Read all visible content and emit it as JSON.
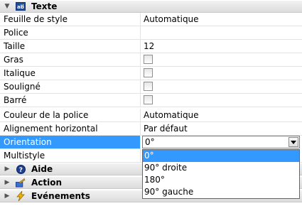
{
  "categories": {
    "texte": {
      "label": "Texte",
      "icon": "text-field-icon"
    },
    "aide": {
      "label": "Aide",
      "icon": "help-icon"
    },
    "action": {
      "label": "Action",
      "icon": "action-icon"
    },
    "evenements": {
      "label": "Evénements",
      "icon": "lightning-icon"
    }
  },
  "properties": {
    "feuille_de_style": {
      "label": "Feuille de style",
      "value": "Automatique"
    },
    "police": {
      "label": "Police",
      "value": ""
    },
    "taille": {
      "label": "Taille",
      "value": "12"
    },
    "gras": {
      "label": "Gras",
      "checked": false
    },
    "italique": {
      "label": "Italique",
      "checked": false
    },
    "souligne": {
      "label": "Souligné",
      "checked": false
    },
    "barre": {
      "label": "Barré",
      "checked": false
    },
    "couleur": {
      "label": "Couleur de la police",
      "value": "Automatique"
    },
    "alignement": {
      "label": "Alignement horizontal",
      "value": "Par défaut"
    },
    "orientation": {
      "label": "Orientation",
      "value": "0°"
    },
    "multistyle": {
      "label": "Multistyle",
      "value": ""
    }
  },
  "orientation_dropdown": {
    "options": [
      "0°",
      "90° droite",
      "180°",
      "90° gauche"
    ],
    "selected": "0°"
  },
  "colors": {
    "selection": "#3399ff",
    "header_gradient_top": "#f2f2f2",
    "header_gradient_bottom": "#dcdcdc",
    "grid_line": "#e3e3e3"
  }
}
